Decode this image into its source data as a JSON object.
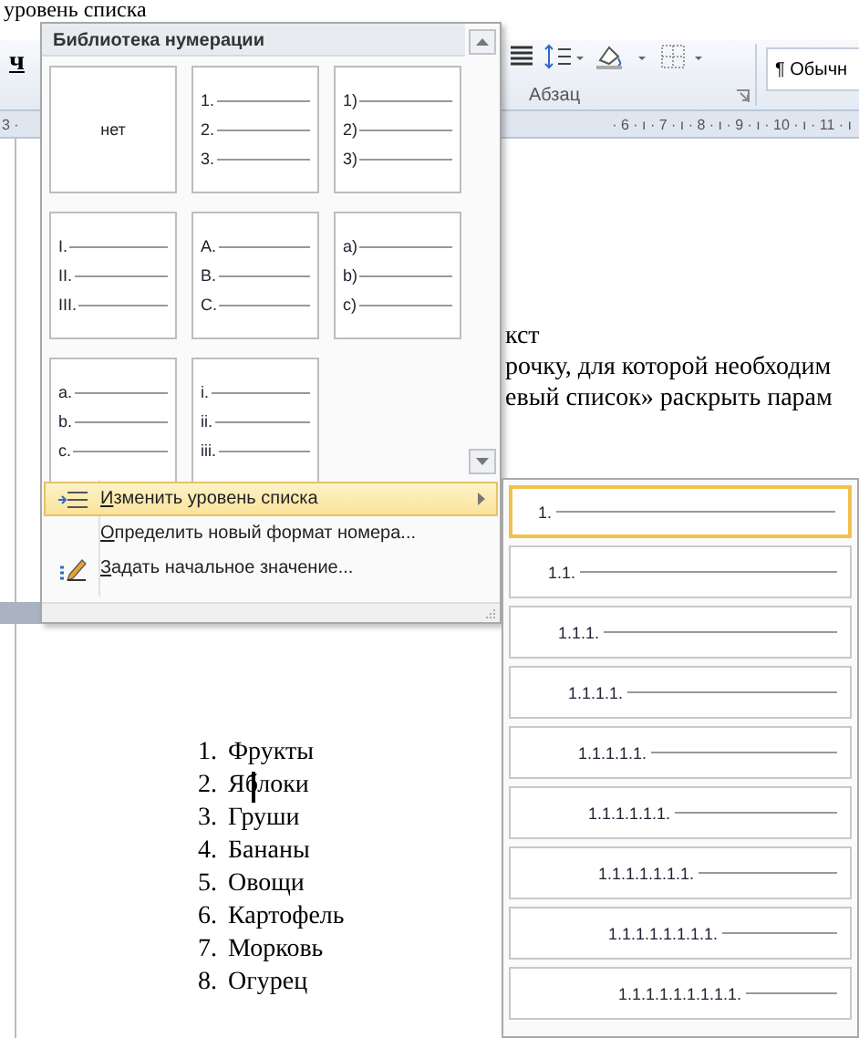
{
  "heading": "уровень списка",
  "ribbon": {
    "font_button": "ч",
    "style_box": "¶ Обычн",
    "group_label": "Абзац"
  },
  "ruler": {
    "left": "3 ·",
    "right": "· 6 · ı · 7 · ı · 8 · ı · 9 · ı · 10 · ı · 11 · ı"
  },
  "document": {
    "lines": [
      "кст",
      "рочку, для которой необходим",
      "евый список» раскрыть парам"
    ],
    "list": [
      {
        "number": "1.",
        "text": "Фрукты"
      },
      {
        "number": "2.",
        "text": "Яблоки",
        "cursor": true
      },
      {
        "number": "3.",
        "text": "Груши"
      },
      {
        "number": "4.",
        "text": "Бананы"
      },
      {
        "number": "5.",
        "text": "Овощи"
      },
      {
        "number": "6.",
        "text": "Картофель"
      },
      {
        "number": "7.",
        "text": "Морковь"
      },
      {
        "number": "8.",
        "text": "Огурец"
      }
    ]
  },
  "numbering_menu": {
    "title": "Библиотека нумерации",
    "formats": [
      {
        "kind": "none",
        "label": "нет"
      },
      {
        "kind": "list",
        "markers": [
          "1.",
          "2.",
          "3."
        ]
      },
      {
        "kind": "list",
        "markers": [
          "1)",
          "2)",
          "3)"
        ]
      },
      {
        "kind": "list",
        "markers": [
          "I.",
          "II.",
          "III."
        ]
      },
      {
        "kind": "list",
        "markers": [
          "A.",
          "B.",
          "C."
        ]
      },
      {
        "kind": "list",
        "markers": [
          "a)",
          "b)",
          "c)"
        ]
      },
      {
        "kind": "list",
        "markers": [
          "a.",
          "b.",
          "c."
        ]
      },
      {
        "kind": "list",
        "markers": [
          "i.",
          "ii.",
          "iii."
        ]
      }
    ],
    "items": [
      {
        "label": "Изменить уровень списка",
        "selected": true,
        "kind": "level",
        "submenu": true
      },
      {
        "label": "Определить новый формат номера...",
        "selected": false,
        "kind": "plain"
      },
      {
        "label": "Задать начальное значение...",
        "selected": false,
        "kind": "start"
      }
    ]
  },
  "level_menu": {
    "levels": [
      {
        "marker": "1.",
        "selected": true
      },
      {
        "marker": "1.1.",
        "selected": false
      },
      {
        "marker": "1.1.1.",
        "selected": false
      },
      {
        "marker": "1.1.1.1.",
        "selected": false
      },
      {
        "marker": "1.1.1.1.1.",
        "selected": false
      },
      {
        "marker": "1.1.1.1.1.1.",
        "selected": false
      },
      {
        "marker": "1.1.1.1.1.1.1.",
        "selected": false
      },
      {
        "marker": "1.1.1.1.1.1.1.1.",
        "selected": false
      },
      {
        "marker": "1.1.1.1.1.1.1.1.1.",
        "selected": false
      }
    ]
  }
}
